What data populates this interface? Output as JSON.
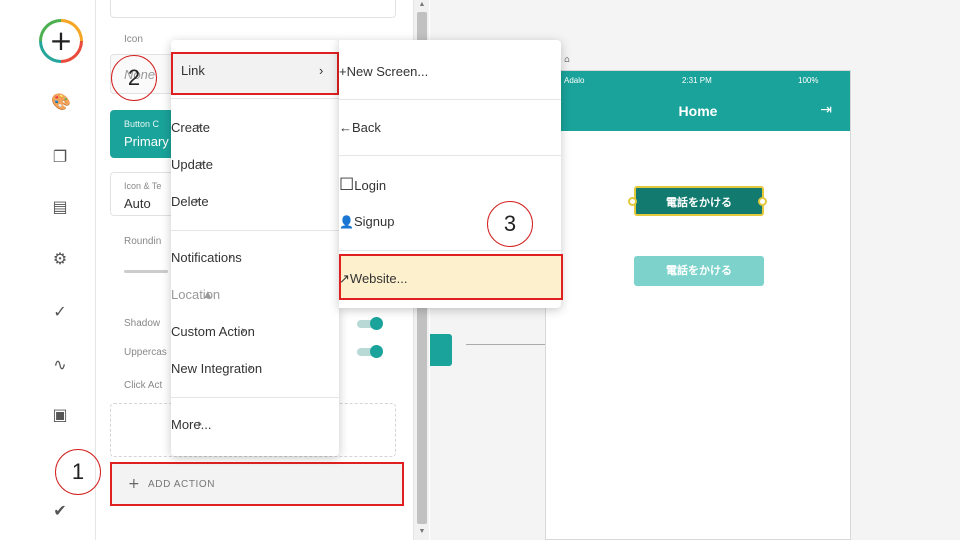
{
  "rail": {
    "add_symbol": "+",
    "icons": [
      "palette-icon",
      "screens-icon",
      "document-icon",
      "gear-icon",
      "checkmarks-icon",
      "analytics-icon",
      "publish-icon",
      "badge-icon"
    ]
  },
  "panel": {
    "icon_label": "Icon",
    "icon_placeholder": "None",
    "button_color_label": "Button C",
    "button_color_value": "Primary",
    "icon_text_label": "Icon & Te",
    "icon_text_value": "Auto",
    "rounding_label": "Roundin",
    "shadow_label": "Shadow",
    "uppercase_label": "Uppercas",
    "click_actions_label": "Click Act",
    "add_action_label": "ADD ACTION"
  },
  "menu1": {
    "items": [
      {
        "label": "Link",
        "chevron": "›"
      },
      {
        "label": "Create",
        "chevron": "›"
      },
      {
        "label": "Update",
        "chevron": "›"
      },
      {
        "label": "Delete",
        "chevron": "›"
      },
      {
        "label": "Notifications",
        "chevron": "›"
      },
      {
        "label": "Location",
        "chevron": "▲"
      },
      {
        "label": "Custom Action",
        "chevron": "›"
      },
      {
        "label": "New Integration",
        "chevron": "›"
      },
      {
        "label": "More...",
        "chevron": "›"
      }
    ]
  },
  "menu2": {
    "items": [
      {
        "label": "New Screen...",
        "icon": "+"
      },
      {
        "label": "Back",
        "icon": "←"
      },
      {
        "label": "Login",
        "icon": "☐"
      },
      {
        "label": "Signup",
        "icon": "👤"
      },
      {
        "label": "Website...",
        "icon": "↗"
      }
    ]
  },
  "canvas": {
    "screen_name": "me",
    "screen_icon": "⌂",
    "status_carrier": "Adalo",
    "status_time": "2:31 PM",
    "status_battery": "100%",
    "app_title": "Home",
    "button_selected": "電話をかける",
    "button_disabled": "電話をかける"
  },
  "callouts": [
    "1",
    "2",
    "3"
  ],
  "colors": {
    "accent": "#1aa39a",
    "highlight": "#e02020",
    "website_highlight": "#fdf0cd"
  }
}
